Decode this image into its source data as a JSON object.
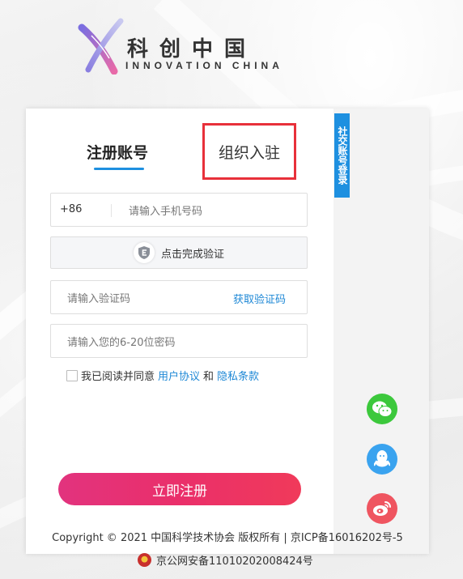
{
  "logo": {
    "cn": "科创中国",
    "en": "INNOVATION CHINA"
  },
  "tabs": {
    "register": "注册账号",
    "organization": "组织入驻"
  },
  "social_tab": "社交账号登录",
  "phone": {
    "country_code": "+86",
    "placeholder": "请输入手机号码"
  },
  "verify": {
    "label": "点击完成验证"
  },
  "code": {
    "placeholder": "请输入验证码",
    "get_code": "获取验证码"
  },
  "password": {
    "placeholder": "请输入您的6-20位密码"
  },
  "agreement": {
    "prefix": "我已阅读并同意",
    "user_agreement": "用户协议",
    "and": "和",
    "privacy": "隐私条款"
  },
  "submit_label": "立即注册",
  "footer": {
    "copyright": "Copyright © 2021 中国科学技术协会 版权所有 | 京ICP备16016202号-5",
    "police": "京公网安备11010202008424号"
  },
  "colors": {
    "accent": "#1e90e0",
    "highlight_border": "#e8303a",
    "submit_start": "#e2337e",
    "submit_end": "#f03a5a"
  }
}
